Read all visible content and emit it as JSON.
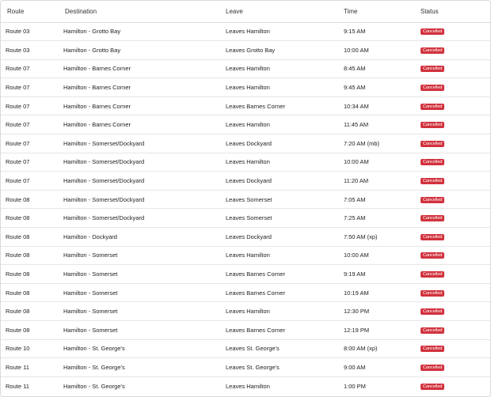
{
  "columns": {
    "route": "Route",
    "destination": "Destination",
    "leave": "Leave",
    "time": "Time",
    "status": "Status"
  },
  "rows": [
    {
      "route": "Route 03",
      "destination": "Hamilton - Grotto Bay",
      "leave": "Leaves Hamilton",
      "time": "9:15 AM",
      "status": "Cancelled"
    },
    {
      "route": "Route 03",
      "destination": "Hamilton - Grotto Bay",
      "leave": "Leaves Grotto Bay",
      "time": "10:00 AM",
      "status": "Cancelled"
    },
    {
      "route": "Route 07",
      "destination": "Hamilton - Barnes Corner",
      "leave": "Leaves Hamilton",
      "time": "8:45 AM",
      "status": "Cancelled"
    },
    {
      "route": "Route 07",
      "destination": "Hamilton - Barnes Corner",
      "leave": "Leaves Hamilton",
      "time": "9:45 AM",
      "status": "Cancelled"
    },
    {
      "route": "Route 07",
      "destination": "Hamilton - Barnes Corner",
      "leave": "Leaves Barnes Corner",
      "time": "10:34 AM",
      "status": "Cancelled"
    },
    {
      "route": "Route 07",
      "destination": "Hamilton - Barnes Corner",
      "leave": "Leaves Hamilton",
      "time": "11:45 AM",
      "status": "Cancelled"
    },
    {
      "route": "Route 07",
      "destination": "Hamilton - Somerset/Dockyard",
      "leave": "Leaves Dockyard",
      "time": "7:20 AM (mb)",
      "status": "Cancelled"
    },
    {
      "route": "Route 07",
      "destination": "Hamilton - Somerset/Dockyard",
      "leave": "Leaves Hamilton",
      "time": "10:00 AM",
      "status": "Cancelled"
    },
    {
      "route": "Route 07",
      "destination": "Hamilton - Somerset/Dockyard",
      "leave": "Leaves Dockyard",
      "time": "11:20 AM",
      "status": "Cancelled"
    },
    {
      "route": "Route 08",
      "destination": "Hamilton - Somerset/Dockyard",
      "leave": "Leaves Somerset",
      "time": "7:05 AM",
      "status": "Cancelled"
    },
    {
      "route": "Route 08",
      "destination": "Hamilton - Somerset/Dockyard",
      "leave": "Leaves Somerset",
      "time": "7:25 AM",
      "status": "Cancelled"
    },
    {
      "route": "Route 08",
      "destination": "Hamilton - Dockyard",
      "leave": "Leaves Dockyard",
      "time": "7:50 AM (xp)",
      "status": "Cancelled"
    },
    {
      "route": "Route 08",
      "destination": "Hamilton - Somerset",
      "leave": "Leaves Hamilton",
      "time": "10:00 AM",
      "status": "Cancelled"
    },
    {
      "route": "Route 08",
      "destination": "Hamilton - Somerset",
      "leave": "Leaves Barnes Corner",
      "time": "9:19 AM",
      "status": "Cancelled"
    },
    {
      "route": "Route 08",
      "destination": "Hamilton - Somerset",
      "leave": "Leaves Barnes Corner",
      "time": "10:19 AM",
      "status": "Cancelled"
    },
    {
      "route": "Route 08",
      "destination": "Hamilton - Somerset",
      "leave": "Leaves Hamilton",
      "time": "12:30 PM",
      "status": "Cancelled"
    },
    {
      "route": "Route 08",
      "destination": "Hamilton - Somerset",
      "leave": "Leaves Barnes Corner",
      "time": "12:19 PM",
      "status": "Cancelled"
    },
    {
      "route": "Route 10",
      "destination": "Hamilton - St. George's",
      "leave": "Leaves St. George's",
      "time": "8:00 AM (xp)",
      "status": "Cancelled"
    },
    {
      "route": "Route 11",
      "destination": "Hamilton - St. George's",
      "leave": "Leaves St. George's",
      "time": "9:00 AM",
      "status": "Cancelled"
    },
    {
      "route": "Route 11",
      "destination": "Hamilton - St. George's",
      "leave": "Leaves Hamilton",
      "time": "1:00 PM",
      "status": "Cancelled"
    }
  ],
  "colors": {
    "status_cancelled": "#d1323d",
    "border": "#d9d9d9",
    "row_divider": "#e6e6e6"
  }
}
